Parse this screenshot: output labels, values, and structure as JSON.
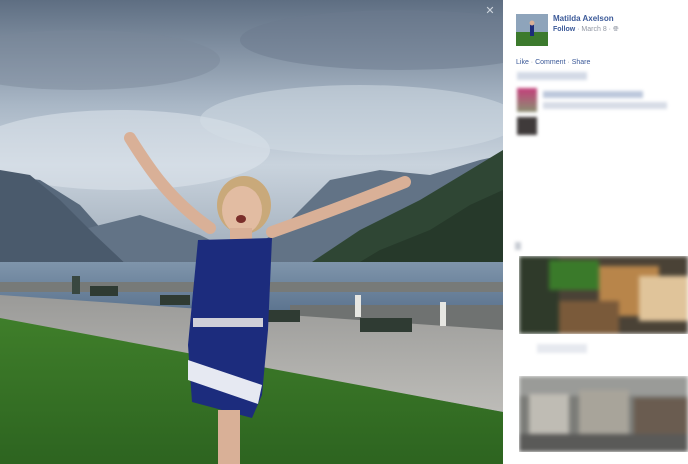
{
  "photo": {
    "close_icon": "close-icon",
    "subject": "woman with arms raised on a lakeside promenade at dusk"
  },
  "sidebar": {
    "author_name": "Matilda Axelson",
    "follow_label": "Follow",
    "separator": "·",
    "date": "March 8",
    "privacy_icon": "globe-icon",
    "actions": {
      "like": "Like",
      "comment": "Comment",
      "share": "Share",
      "separator": "·"
    }
  },
  "colors": {
    "link": "#3b5998",
    "meta": "#9197a3"
  }
}
